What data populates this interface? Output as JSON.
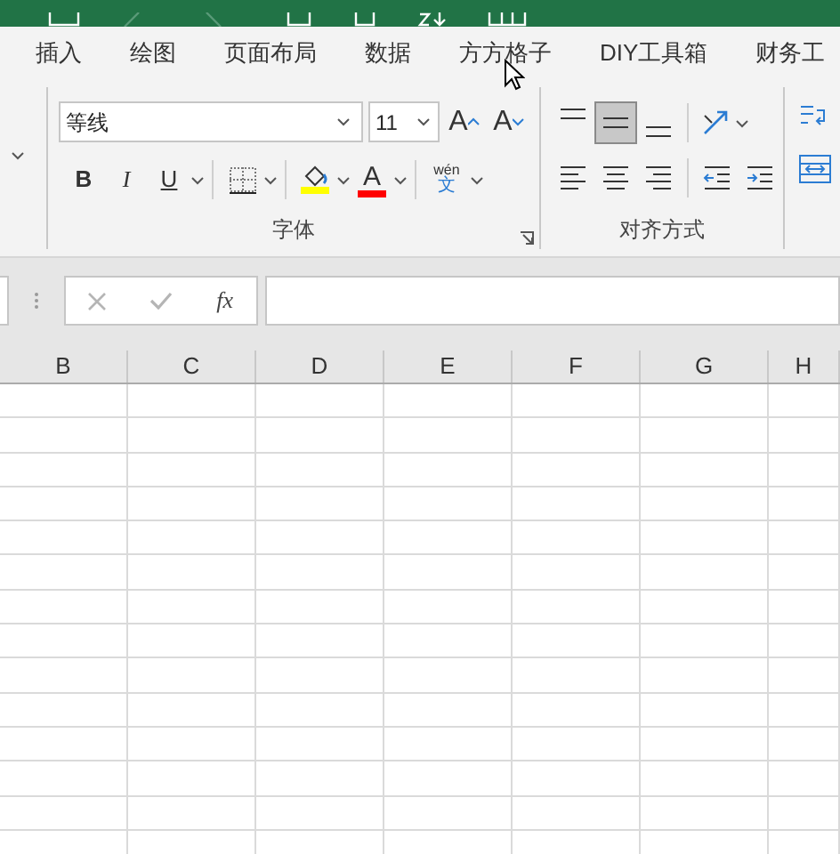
{
  "tabs": [
    {
      "label": "插入",
      "selected": false
    },
    {
      "label": "绘图",
      "selected": false
    },
    {
      "label": "页面布局",
      "selected": false
    },
    {
      "label": "数据",
      "selected": false
    },
    {
      "label": "方方格子",
      "selected": false
    },
    {
      "label": "DIY工具箱",
      "selected": false
    },
    {
      "label": "财务工",
      "selected": false
    }
  ],
  "font_group": {
    "label": "字体",
    "font_name": "等线",
    "font_size": "11",
    "grow_label": "A",
    "shrink_label": "A",
    "format_buttons": [
      {
        "kind": "bold",
        "label": "B"
      },
      {
        "kind": "italic",
        "label": "I"
      },
      {
        "kind": "underline",
        "label": "U"
      }
    ],
    "font_color_label": "A",
    "phonetic_top": "wén",
    "phonetic_bottom": "文"
  },
  "alignment_group": {
    "label": "对齐方式",
    "vertical": [
      {
        "kind": "top",
        "selected": false
      },
      {
        "kind": "middle",
        "selected": true
      },
      {
        "kind": "bottom",
        "selected": false
      }
    ],
    "horizontal": [
      {
        "kind": "left",
        "selected": false
      },
      {
        "kind": "center",
        "selected": false
      },
      {
        "kind": "right",
        "selected": false
      }
    ]
  },
  "formula_bar": {
    "function_label": "fx"
  },
  "columns": [
    "B",
    "C",
    "D",
    "E",
    "F",
    "G",
    "H"
  ]
}
